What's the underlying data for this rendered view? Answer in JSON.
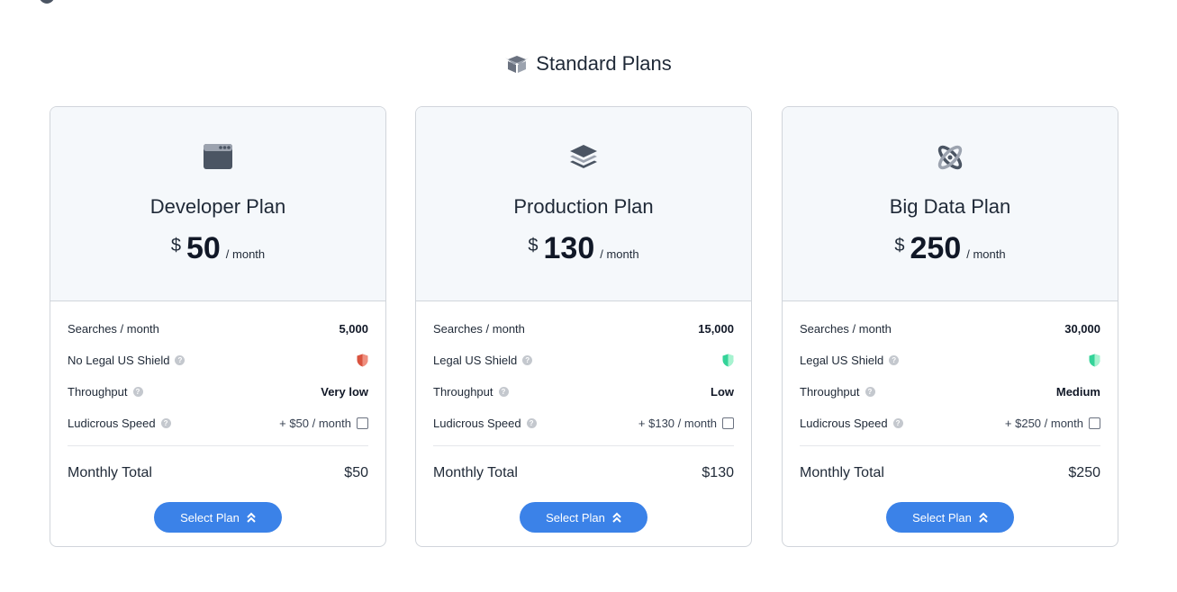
{
  "section": {
    "title": "Standard Plans"
  },
  "plans": [
    {
      "name": "Developer Plan",
      "currency": "$",
      "price": "50",
      "period": "/ month",
      "features": {
        "searches_label": "Searches / month",
        "searches_value": "5,000",
        "shield_label": "No Legal US Shield",
        "shield_status": "off",
        "throughput_label": "Throughput",
        "throughput_value": "Very low",
        "speed_label": "Ludicrous Speed",
        "speed_value": "+ $50 / month"
      },
      "total_label": "Monthly Total",
      "total_value": "$50",
      "button_label": "Select Plan",
      "icon": "browser-window-icon"
    },
    {
      "name": "Production Plan",
      "currency": "$",
      "price": "130",
      "period": "/ month",
      "features": {
        "searches_label": "Searches / month",
        "searches_value": "15,000",
        "shield_label": "Legal US Shield",
        "shield_status": "on",
        "throughput_label": "Throughput",
        "throughput_value": "Low",
        "speed_label": "Ludicrous Speed",
        "speed_value": "+ $130 / month"
      },
      "total_label": "Monthly Total",
      "total_value": "$130",
      "button_label": "Select Plan",
      "icon": "layers-icon"
    },
    {
      "name": "Big Data Plan",
      "currency": "$",
      "price": "250",
      "period": "/ month",
      "features": {
        "searches_label": "Searches / month",
        "searches_value": "30,000",
        "shield_label": "Legal US Shield",
        "shield_status": "on",
        "throughput_label": "Throughput",
        "throughput_value": "Medium",
        "speed_label": "Ludicrous Speed",
        "speed_value": "+ $250 / month"
      },
      "total_label": "Monthly Total",
      "total_value": "$250",
      "button_label": "Select Plan",
      "icon": "atom-icon"
    }
  ],
  "colors": {
    "accent": "#3b82e8",
    "shield_off": "#d9533f",
    "shield_on": "#34d399",
    "header_bg": "#f5f8fb"
  }
}
